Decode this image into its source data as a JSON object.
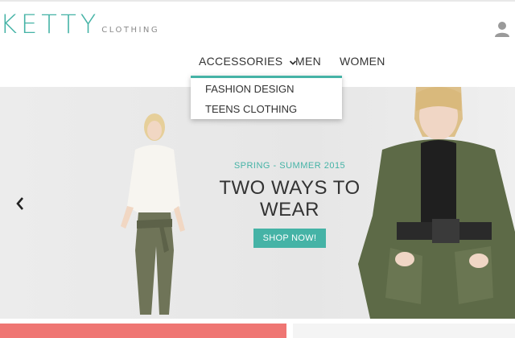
{
  "brand": {
    "name": "KETTY",
    "sub": "CLOTHING",
    "accent": "#45b3a6"
  },
  "header": {
    "user_icon": "user-icon"
  },
  "nav": {
    "items": [
      {
        "label": "ACCESSORIES",
        "has_dropdown": true
      },
      {
        "label": "MEN"
      },
      {
        "label": "WOMEN"
      }
    ],
    "dropdown": [
      "FASHION DESIGN",
      "TEENS CLOTHING"
    ]
  },
  "hero": {
    "season": "SPRING - SUMMER 2015",
    "title_line1": "TWO WAYS TO",
    "title_line2": "WEAR",
    "cta": "SHOP NOW!",
    "prev_icon": "chevron-left-icon"
  },
  "colors": {
    "accent": "#45b3a6",
    "coral": "#ef7673"
  }
}
